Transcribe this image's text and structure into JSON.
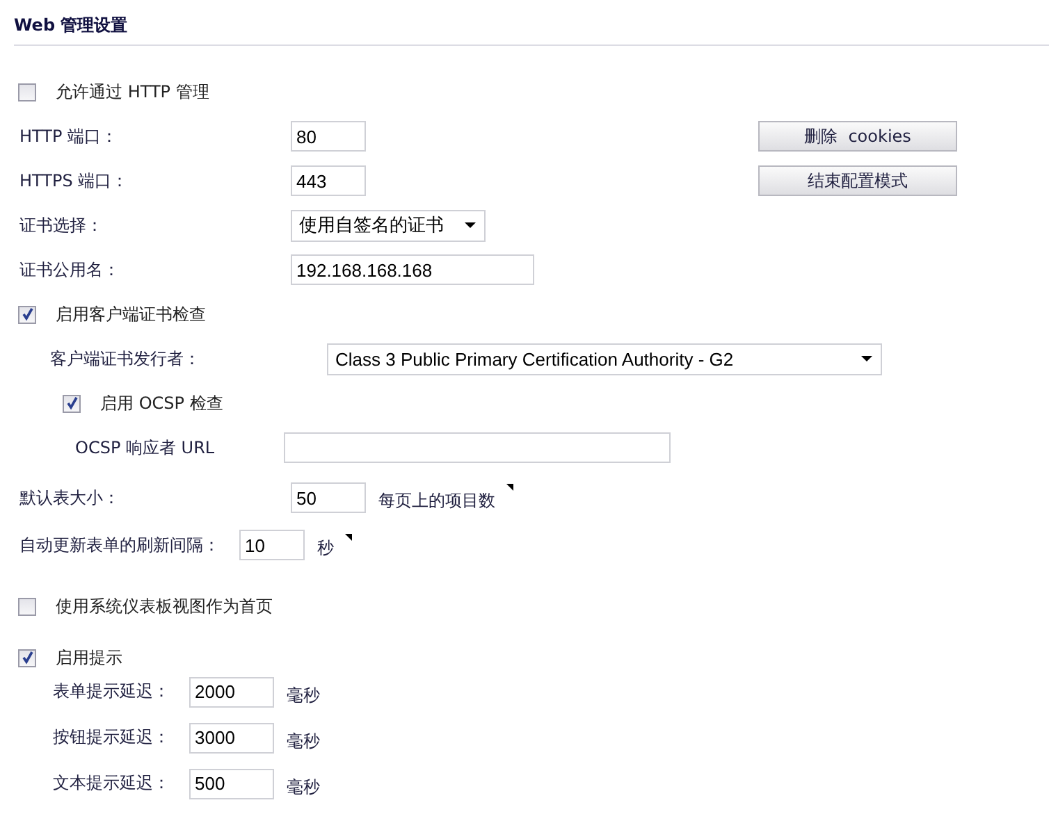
{
  "title": "Web 管理设置",
  "allow_http": {
    "label": "允许通过  HTTP 管理",
    "checked": false
  },
  "http_port": {
    "label": "HTTP 端口：",
    "value": "80"
  },
  "delete_cookies_button": "删除  cookies",
  "https_port": {
    "label": "HTTPS 端口：",
    "value": "443"
  },
  "end_config_button": "结束配置模式",
  "cert_select": {
    "label": "证书选择：",
    "value": "使用自签名的证书"
  },
  "cert_common_name": {
    "label": "证书公用名：",
    "value": "192.168.168.168"
  },
  "client_cert_check": {
    "label": "启用客户端证书检查",
    "checked": true,
    "issuer": {
      "label": "客户端证书发行者：",
      "value": "Class 3 Public Primary Certification Authority - G2"
    },
    "ocsp": {
      "label": "启用  OCSP 检查",
      "checked": true,
      "responder": {
        "label": "OCSP 响应者  URL"
      }
    }
  },
  "table_size": {
    "label": "默认表大小：",
    "value": "50",
    "unit": "每页上的项目数"
  },
  "refresh_interval": {
    "label": "自动更新表单的刷新间隔：",
    "value": "10",
    "unit": "秒"
  },
  "dashboard_home": {
    "label": "使用系统仪表板视图作为首页",
    "checked": false
  },
  "tooltips": {
    "label": "启用提示",
    "checked": true,
    "delays": [
      {
        "label": "表单提示延迟：",
        "value": "2000",
        "unit": "毫秒"
      },
      {
        "label": "按钮提示延迟：",
        "value": "3000",
        "unit": "毫秒"
      },
      {
        "label": "文本提示延迟：",
        "value": "500",
        "unit": "毫秒"
      }
    ]
  }
}
